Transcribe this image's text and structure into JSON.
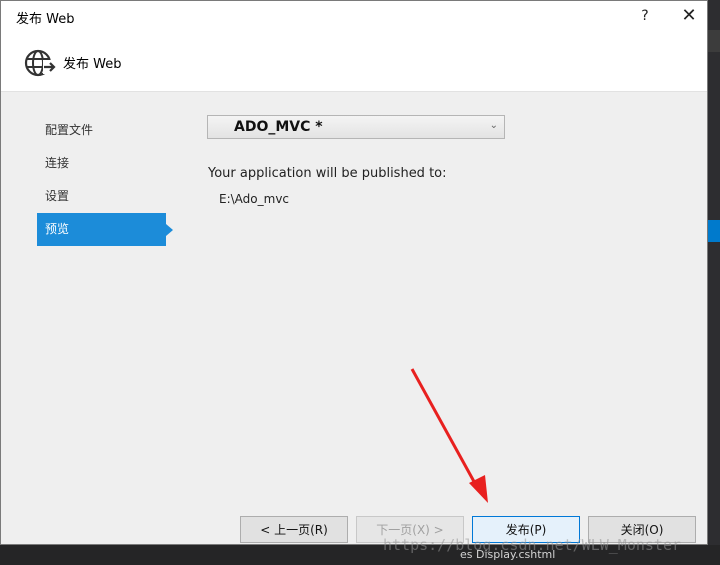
{
  "window": {
    "title": "发布 Web",
    "help_glyph": "?",
    "close_glyph": "✕"
  },
  "header": {
    "title": "发布 Web",
    "icon": "globe-publish-icon"
  },
  "nav": {
    "items": [
      {
        "label": "配置文件",
        "active": false
      },
      {
        "label": "连接",
        "active": false
      },
      {
        "label": "设置",
        "active": false
      },
      {
        "label": "预览",
        "active": true
      }
    ]
  },
  "profile": {
    "selected": "ADO_MVC *",
    "chevron": "⌄"
  },
  "preview": {
    "publish_label": "Your application will be published to:",
    "publish_path": "E:\\Ado_mvc"
  },
  "buttons": {
    "prev": "< 上一页(R)",
    "next": "下一页(X) >",
    "publish": "发布(P)",
    "close": "关闭(O)"
  },
  "background": {
    "status_text": "es Display.cshtml"
  },
  "watermark": "https://blog.csdn.net/WLW_Monster",
  "colors": {
    "accent": "#1c8cd9",
    "arrow": "#e8201f"
  }
}
